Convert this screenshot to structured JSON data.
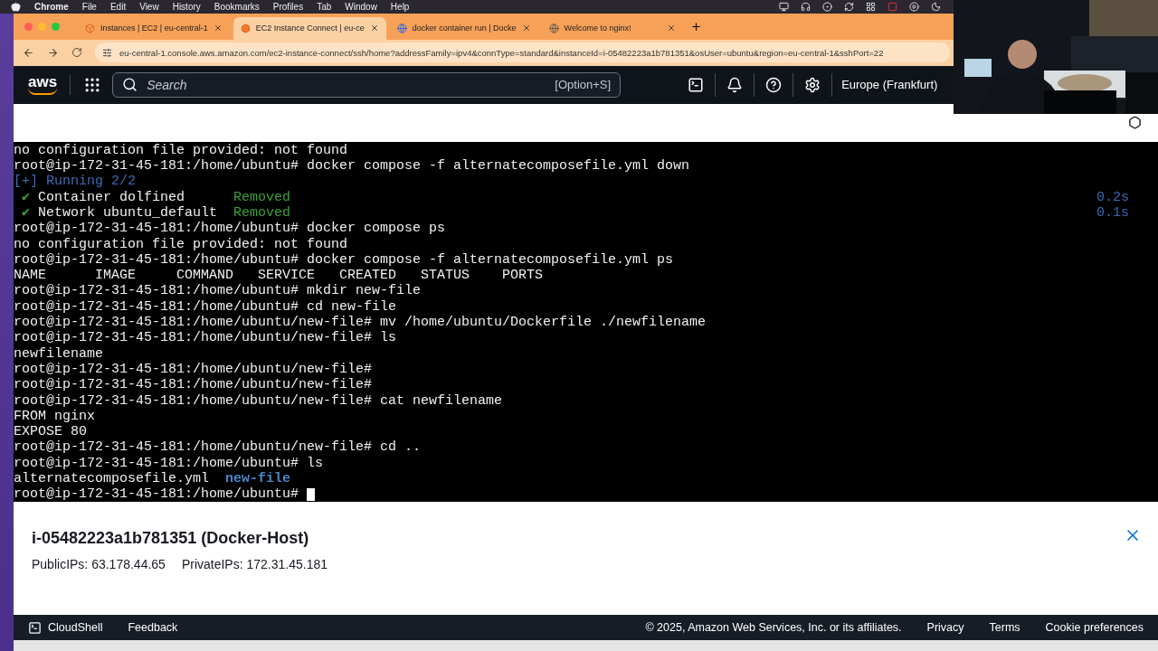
{
  "menu_bar": {
    "app": "Chrome",
    "items": [
      "File",
      "Edit",
      "View",
      "History",
      "Bookmarks",
      "Profiles",
      "Tab",
      "Window",
      "Help"
    ]
  },
  "browser": {
    "tabs": [
      {
        "kind": "aws",
        "title": "Instances | EC2 | eu-central-1",
        "selected": false
      },
      {
        "kind": "cube",
        "title": "EC2 Instance Connect | eu-ce",
        "selected": true
      },
      {
        "kind": "docker",
        "title": "docker container run | Docke",
        "selected": false
      },
      {
        "kind": "globe",
        "title": "Welcome to nginx!",
        "selected": false
      }
    ],
    "url": "eu-central-1.console.aws.amazon.com/ec2-instance-connect/ssh/home?addressFamily=ipv4&connType=standard&instanceId=i-05482223a1b781351&osUser=ubuntu&region=eu-central-1&sshPort=22"
  },
  "console_nav": {
    "logo": "aws",
    "search": {
      "placeholder": "Search",
      "shortcut": "[Option+S]"
    },
    "region": "Europe (Frankfurt)"
  },
  "terminal": {
    "lines": [
      {
        "segments": [
          {
            "kind": "plain",
            "text": "no configuration file provided: not found"
          }
        ]
      },
      {
        "segments": [
          {
            "kind": "plain",
            "text": "root@ip-172-31-45-181:/home/ubuntu# docker compose -f alternatecomposefile.yml down"
          }
        ]
      },
      {
        "segments": [
          {
            "kind": "info",
            "text": "[+] Running 2/2"
          }
        ]
      },
      {
        "segments": [
          {
            "kind": "ok",
            "text": " ✔"
          },
          {
            "kind": "plain",
            "text": " Container dolfined      "
          },
          {
            "kind": "ok",
            "text": "Removed"
          }
        ],
        "timing": "0.2s"
      },
      {
        "segments": [
          {
            "kind": "ok",
            "text": " ✔"
          },
          {
            "kind": "plain",
            "text": " Network ubuntu_default  "
          },
          {
            "kind": "ok",
            "text": "Removed"
          }
        ],
        "timing": "0.1s"
      },
      {
        "segments": [
          {
            "kind": "plain",
            "text": "root@ip-172-31-45-181:/home/ubuntu# docker compose ps"
          }
        ]
      },
      {
        "segments": [
          {
            "kind": "plain",
            "text": "no configuration file provided: not found"
          }
        ]
      },
      {
        "segments": [
          {
            "kind": "plain",
            "text": "root@ip-172-31-45-181:/home/ubuntu# docker compose -f alternatecomposefile.yml ps"
          }
        ]
      },
      {
        "segments": [
          {
            "kind": "plain",
            "text": "NAME      IMAGE     COMMAND   SERVICE   CREATED   STATUS    PORTS"
          }
        ]
      },
      {
        "segments": [
          {
            "kind": "plain",
            "text": "root@ip-172-31-45-181:/home/ubuntu# mkdir new-file"
          }
        ]
      },
      {
        "segments": [
          {
            "kind": "plain",
            "text": "root@ip-172-31-45-181:/home/ubuntu# cd new-file"
          }
        ]
      },
      {
        "segments": [
          {
            "kind": "plain",
            "text": "root@ip-172-31-45-181:/home/ubuntu/new-file# mv /home/ubuntu/Dockerfile ./newfilename"
          }
        ]
      },
      {
        "segments": [
          {
            "kind": "plain",
            "text": "root@ip-172-31-45-181:/home/ubuntu/new-file# ls"
          }
        ]
      },
      {
        "segments": [
          {
            "kind": "plain",
            "text": "newfilename"
          }
        ]
      },
      {
        "segments": [
          {
            "kind": "plain",
            "text": "root@ip-172-31-45-181:/home/ubuntu/new-file#"
          }
        ]
      },
      {
        "segments": [
          {
            "kind": "plain",
            "text": "root@ip-172-31-45-181:/home/ubuntu/new-file#"
          }
        ]
      },
      {
        "segments": [
          {
            "kind": "plain",
            "text": "root@ip-172-31-45-181:/home/ubuntu/new-file# cat newfilename"
          }
        ]
      },
      {
        "segments": [
          {
            "kind": "plain",
            "text": "FROM nginx"
          }
        ]
      },
      {
        "segments": [
          {
            "kind": "plain",
            "text": "EXPOSE 80"
          }
        ]
      },
      {
        "segments": [
          {
            "kind": "plain",
            "text": "root@ip-172-31-45-181:/home/ubuntu/new-file# cd .."
          }
        ]
      },
      {
        "segments": [
          {
            "kind": "plain",
            "text": "root@ip-172-31-45-181:/home/ubuntu# ls"
          }
        ]
      },
      {
        "segments": [
          {
            "kind": "plain",
            "text": "alternatecomposefile.yml  "
          },
          {
            "kind": "dir",
            "text": "new-file"
          }
        ]
      },
      {
        "segments": [
          {
            "kind": "plain",
            "text": "root@ip-172-31-45-181:/home/ubuntu# "
          }
        ],
        "cursor": true
      }
    ]
  },
  "instance": {
    "title": "i-05482223a1b781351 (Docker-Host)",
    "public_ips": "PublicIPs: 63.178.44.65",
    "private_ips": "PrivateIPs: 172.31.45.181"
  },
  "footer": {
    "cloudshell": "CloudShell",
    "feedback": "Feedback",
    "copyright": "© 2025, Amazon Web Services, Inc. or its affiliates.",
    "links": [
      "Privacy",
      "Terms",
      "Cookie preferences"
    ]
  }
}
